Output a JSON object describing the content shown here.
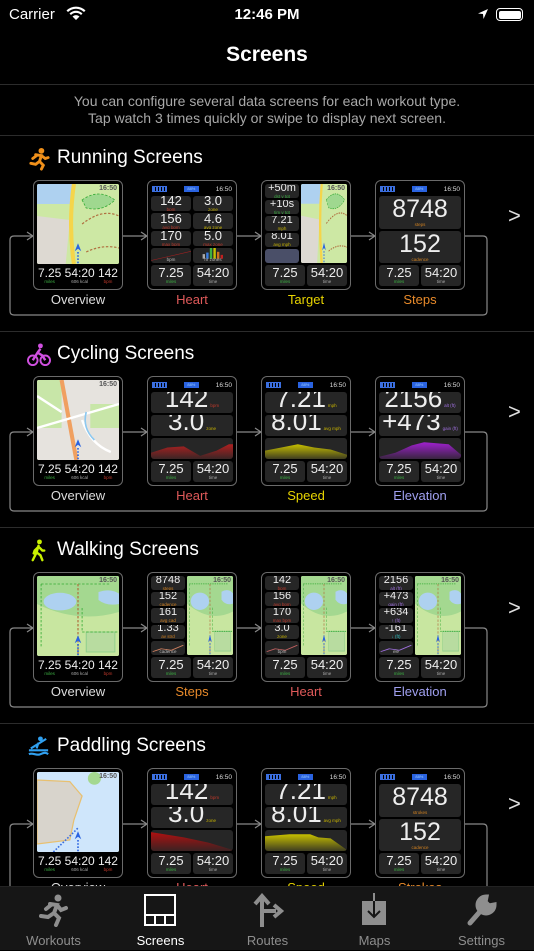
{
  "status_bar": {
    "carrier": "Carrier",
    "time": "12:46 PM"
  },
  "header": {
    "title": "Screens"
  },
  "description": [
    "You can configure several data screens for each workout type.",
    "Tap watch 3 times quickly or swipe to display next screen."
  ],
  "colors": {
    "green": "#3cb043",
    "red": "#c0392b",
    "yellow": "#c8b400",
    "orange": "#d08020",
    "purple": "#a070e0",
    "cyan": "#30c0c0",
    "gray": "#aaaaaa",
    "accent_blue": "#2a63e0"
  },
  "watch_status": {
    "battery": "88%",
    "clock": "16:50"
  },
  "map_clock": "16:50",
  "sections": [
    {
      "title": "Running Screens",
      "icon": "running-icon",
      "icon_color": "#f0901a",
      "screens": [
        {
          "label": "Overview",
          "label_color": "#dddddd",
          "type": "map",
          "map": "park",
          "bottom": [
            {
              "v": "7.25",
              "l": "miles",
              "c": "#3cb043"
            },
            {
              "v": "54:20",
              "l": "606 kcal",
              "c": "#aaaaaa"
            },
            {
              "v": "142",
              "l": "bpm",
              "c": "#c0392b"
            }
          ]
        },
        {
          "label": "Heart",
          "label_color": "#e05a5a",
          "type": "tiles",
          "rows": [
            [
              {
                "v": "142",
                "l": "bpm",
                "c": "#c0392b",
                "k": "med"
              },
              {
                "v": "3.0",
                "l": "zone",
                "c": "#c8b400",
                "k": "med"
              }
            ],
            [
              {
                "v": "156",
                "l": "avg bpm",
                "c": "#c0392b",
                "k": "med"
              },
              {
                "v": "4.6",
                "l": "avg zone",
                "c": "#c8b400",
                "k": "med"
              }
            ],
            [
              {
                "v": "170",
                "l": "max bpm",
                "c": "#c0392b",
                "k": "med"
              },
              {
                "v": "5.0",
                "l": "max zone",
                "c": "#c0392b",
                "k": "med"
              }
            ],
            [
              {
                "chart": "rise",
                "l": "bpm",
                "c": "#a02020"
              },
              {
                "chart": "bars",
                "l": "hr zones",
                "c": "#c8b400"
              }
            ]
          ],
          "bottom": [
            {
              "v": "7.25",
              "l": "miles",
              "c": "#3cb043"
            },
            {
              "v": "54:20",
              "l": "time",
              "c": "#aaaaaa"
            }
          ]
        },
        {
          "label": "Target",
          "label_color": "#e8d400",
          "type": "side",
          "map": "park",
          "side": [
            {
              "v": "+50m",
              "l": "dst v tgt",
              "c": "#3cb043"
            },
            {
              "v": "+10s",
              "l": "tim v tgt",
              "c": "#3cb043"
            },
            {
              "v": "7.21",
              "l": "mph",
              "c": "#c8b400"
            },
            {
              "v": "8.01",
              "l": "avg mph",
              "c": "#c8b400"
            }
          ],
          "button": true,
          "bottom": [
            {
              "v": "7.25",
              "l": "miles",
              "c": "#3cb043"
            },
            {
              "v": "54:20",
              "l": "time",
              "c": "#aaaaaa"
            }
          ]
        },
        {
          "label": "Steps",
          "label_color": "#e88a2a",
          "type": "tiles",
          "rows": [
            [
              {
                "v": "8748",
                "l": "steps",
                "c": "#d08020",
                "k": "stack"
              }
            ],
            [
              {
                "v": "152",
                "l": "cadence",
                "c": "#d08020",
                "k": "stack"
              }
            ]
          ],
          "bottom": [
            {
              "v": "7.25",
              "l": "miles",
              "c": "#3cb043"
            },
            {
              "v": "54:20",
              "l": "time",
              "c": "#aaaaaa"
            }
          ]
        }
      ]
    },
    {
      "title": "Cycling Screens",
      "icon": "cycling-icon",
      "icon_color": "#d050e0",
      "screens": [
        {
          "label": "Overview",
          "label_color": "#dddddd",
          "type": "map",
          "map": "street",
          "bottom": [
            {
              "v": "7.25",
              "l": "miles",
              "c": "#3cb043"
            },
            {
              "v": "54:20",
              "l": "606 kcal",
              "c": "#aaaaaa"
            },
            {
              "v": "142",
              "l": "bpm",
              "c": "#c0392b"
            }
          ]
        },
        {
          "label": "Heart",
          "label_color": "#e05a5a",
          "type": "tiles",
          "rows": [
            [
              {
                "v": "142",
                "l": "bpm",
                "c": "#c0392b",
                "k": "big"
              }
            ],
            [
              {
                "v": "3.0",
                "l": "zone",
                "c": "#c8b400",
                "k": "big"
              }
            ],
            [
              {
                "chart": "valley",
                "c": "#b02020"
              }
            ]
          ],
          "bottom": [
            {
              "v": "7.25",
              "l": "miles",
              "c": "#3cb043"
            },
            {
              "v": "54:20",
              "l": "time",
              "c": "#aaaaaa"
            }
          ]
        },
        {
          "label": "Speed",
          "label_color": "#e8d400",
          "type": "tiles",
          "rows": [
            [
              {
                "v": "7.21",
                "l": "mph",
                "c": "#c8b400",
                "k": "big"
              }
            ],
            [
              {
                "v": "8.01",
                "l": "avg mph",
                "c": "#c8b400",
                "k": "big"
              }
            ],
            [
              {
                "chart": "hill",
                "c": "#c8c000"
              }
            ]
          ],
          "bottom": [
            {
              "v": "7.25",
              "l": "miles",
              "c": "#3cb043"
            },
            {
              "v": "54:20",
              "l": "time",
              "c": "#aaaaaa"
            }
          ]
        },
        {
          "label": "Elevation",
          "label_color": "#a0a0f0",
          "type": "tiles",
          "rows": [
            [
              {
                "v": "2156",
                "l": "alt (ft)",
                "c": "#a070e0",
                "k": "big"
              }
            ],
            [
              {
                "v": "+473",
                "l": "gain (ft)",
                "c": "#a070e0",
                "k": "big"
              }
            ],
            [
              {
                "chart": "peak",
                "c": "#a020d0"
              }
            ]
          ],
          "bottom": [
            {
              "v": "7.25",
              "l": "miles",
              "c": "#3cb043"
            },
            {
              "v": "54:20",
              "l": "time",
              "c": "#aaaaaa"
            }
          ]
        }
      ]
    },
    {
      "title": "Walking Screens",
      "icon": "walking-icon",
      "icon_color": "#c8f000",
      "screens": [
        {
          "label": "Overview",
          "label_color": "#dddddd",
          "type": "map",
          "map": "meadow",
          "bottom": [
            {
              "v": "7.25",
              "l": "miles",
              "c": "#3cb043"
            },
            {
              "v": "54:20",
              "l": "606 kcal",
              "c": "#aaaaaa"
            },
            {
              "v": "142",
              "l": "bpm",
              "c": "#c0392b"
            }
          ]
        },
        {
          "label": "Steps",
          "label_color": "#e88a2a",
          "type": "side",
          "map": "meadow",
          "side": [
            {
              "v": "8748",
              "l": "steps",
              "c": "#d08020"
            },
            {
              "v": "152",
              "l": "cadence",
              "c": "#d08020"
            },
            {
              "v": "161",
              "l": "avg cad",
              "c": "#d08020"
            },
            {
              "v": "1.33",
              "l": "av strd",
              "c": "#d08020"
            },
            {
              "chart": "line",
              "l": "cadence",
              "c": "#d08060"
            }
          ],
          "bottom": [
            {
              "v": "7.25",
              "l": "miles",
              "c": "#3cb043"
            },
            {
              "v": "54:20",
              "l": "time",
              "c": "#aaaaaa"
            }
          ]
        },
        {
          "label": "Heart",
          "label_color": "#e05a5a",
          "type": "side",
          "map": "meadow",
          "side": [
            {
              "v": "142",
              "l": "bpm",
              "c": "#c0392b"
            },
            {
              "v": "156",
              "l": "avg bpm",
              "c": "#c0392b"
            },
            {
              "v": "170",
              "l": "max bpm",
              "c": "#c0392b"
            },
            {
              "v": "3.0",
              "l": "zone",
              "c": "#c8b400"
            },
            {
              "chart": "line",
              "l": "bpm",
              "c": "#c06060"
            }
          ],
          "bottom": [
            {
              "v": "7.25",
              "l": "miles",
              "c": "#3cb043"
            },
            {
              "v": "54:20",
              "l": "time",
              "c": "#aaaaaa"
            }
          ]
        },
        {
          "label": "Elevation",
          "label_color": "#a0a0f0",
          "type": "side",
          "map": "meadow",
          "side": [
            {
              "v": "2156",
              "l": "alt (ft)",
              "c": "#a070e0"
            },
            {
              "v": "+473",
              "l": "gain (ft)",
              "c": "#a070e0"
            },
            {
              "v": "+634",
              "l": "↑ (ft)",
              "c": "#a070e0"
            },
            {
              "v": "-161",
              "l": "↓ (ft)",
              "c": "#30c0c0"
            },
            {
              "chart": "line",
              "l": "ele",
              "c": "#a070e0"
            }
          ],
          "bottom": [
            {
              "v": "7.25",
              "l": "miles",
              "c": "#3cb043"
            },
            {
              "v": "54:20",
              "l": "time",
              "c": "#aaaaaa"
            }
          ]
        }
      ]
    },
    {
      "title": "Paddling Screens",
      "icon": "paddling-icon",
      "icon_color": "#30a0f0",
      "screens": [
        {
          "label": "Overview",
          "label_color": "#dddddd",
          "type": "map",
          "map": "water",
          "bottom": [
            {
              "v": "7.25",
              "l": "miles",
              "c": "#3cb043"
            },
            {
              "v": "54:20",
              "l": "606 kcal",
              "c": "#aaaaaa"
            },
            {
              "v": "142",
              "l": "bpm",
              "c": "#c0392b"
            }
          ]
        },
        {
          "label": "Heart",
          "label_color": "#e05a5a",
          "type": "tiles",
          "rows": [
            [
              {
                "v": "142",
                "l": "bpm",
                "c": "#c0392b",
                "k": "big"
              }
            ],
            [
              {
                "v": "3.0",
                "l": "zone",
                "c": "#c8b400",
                "k": "big"
              }
            ],
            [
              {
                "chart": "fall",
                "c": "#b01010"
              }
            ]
          ],
          "bottom": [
            {
              "v": "7.25",
              "l": "miles",
              "c": "#3cb043"
            },
            {
              "v": "54:20",
              "l": "time",
              "c": "#aaaaaa"
            }
          ]
        },
        {
          "label": "Speed",
          "label_color": "#e8d400",
          "type": "tiles",
          "rows": [
            [
              {
                "v": "7.21",
                "l": "mph",
                "c": "#c8b400",
                "k": "big"
              }
            ],
            [
              {
                "v": "8.01",
                "l": "avg mph",
                "c": "#c8b400",
                "k": "big"
              }
            ],
            [
              {
                "chart": "plateau",
                "c": "#c8c000"
              }
            ]
          ],
          "bottom": [
            {
              "v": "7.25",
              "l": "miles",
              "c": "#3cb043"
            },
            {
              "v": "54:20",
              "l": "time",
              "c": "#aaaaaa"
            }
          ]
        },
        {
          "label": "Strokes",
          "label_color": "#e88a2a",
          "type": "tiles",
          "rows": [
            [
              {
                "v": "8748",
                "l": "strokes",
                "c": "#d08020",
                "k": "stack"
              }
            ],
            [
              {
                "v": "152",
                "l": "cadence",
                "c": "#d08020",
                "k": "stack"
              }
            ]
          ],
          "bottom": [
            {
              "v": "7.25",
              "l": "miles",
              "c": "#3cb043"
            },
            {
              "v": "54:20",
              "l": "time",
              "c": "#aaaaaa"
            }
          ]
        }
      ]
    }
  ],
  "next_glyph": ">",
  "tabs": [
    {
      "label": "Workouts",
      "icon": "running-icon",
      "active": false
    },
    {
      "label": "Screens",
      "icon": "screens-icon",
      "active": true
    },
    {
      "label": "Routes",
      "icon": "routes-icon",
      "active": false
    },
    {
      "label": "Maps",
      "icon": "maps-download-icon",
      "active": false
    },
    {
      "label": "Settings",
      "icon": "wrench-icon",
      "active": false
    }
  ]
}
